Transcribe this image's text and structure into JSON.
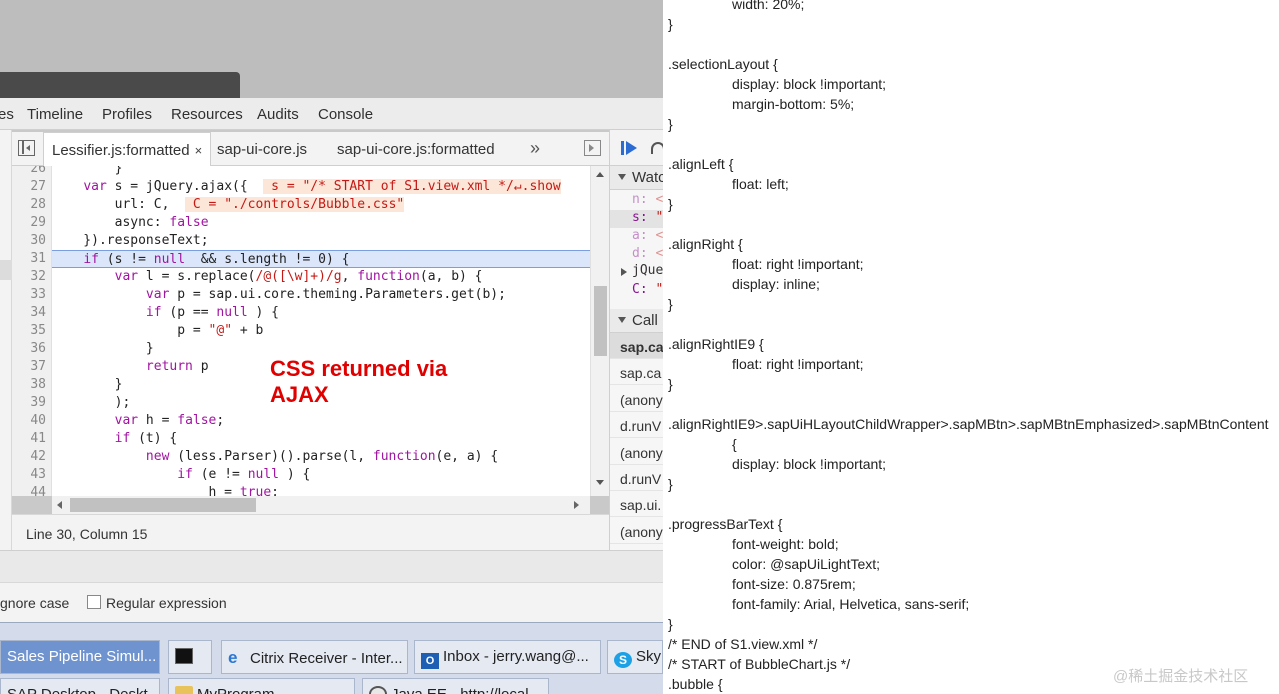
{
  "devtools": {
    "tabs": [
      "es",
      "Timeline",
      "Profiles",
      "Resources",
      "Audits",
      "Console"
    ],
    "file_tabs": [
      "Lessifier.js:formatted",
      "sap-ui-core.js",
      "sap-ui-core.js:formatted"
    ],
    "close_glyph": "×",
    "more_glyph": "»",
    "status": "Line 30, Column 15",
    "annotation": [
      "CSS returned via",
      "AJAX"
    ]
  },
  "code_lines": [
    {
      "n": "26",
      "html": "        }"
    },
    {
      "n": "27",
      "html": "    <span class=\"kw\">var</span> s = jQuery.ajax({  <span class=\"tip\"> s = \"/* START of S1.view.xml */↵.show</span>"
    },
    {
      "n": "28",
      "html": "        url: C,  <span class=\"tip\"> C = <span class=\"str\">\"./controls/Bubble.css\"</span></span>"
    },
    {
      "n": "29",
      "html": "        async: <span class=\"kw\">false</span>"
    },
    {
      "n": "30",
      "html": "    }).responseText;"
    },
    {
      "n": "31",
      "html": "    <span class=\"kw\">if</span> (s != <span class=\"kw\">null</span>  && s.length != 0) {",
      "hl": true
    },
    {
      "n": "32",
      "html": "        <span class=\"kw\">var</span> l = s.replace(<span class=\"re\">/@([\\w]+)/g</span>, <span class=\"kw\">function</span>(a, b) {"
    },
    {
      "n": "33",
      "html": "            <span class=\"kw\">var</span> p = sap.ui.core.theming.Parameters.get(b);"
    },
    {
      "n": "34",
      "html": "            <span class=\"kw\">if</span> (p == <span class=\"kw\">null</span> ) {"
    },
    {
      "n": "35",
      "html": "                p = <span class=\"str\">\"@\"</span> + b"
    },
    {
      "n": "36",
      "html": "            }"
    },
    {
      "n": "37",
      "html": "            <span class=\"kw\">return</span> p"
    },
    {
      "n": "38",
      "html": "        }"
    },
    {
      "n": "39",
      "html": "        );"
    },
    {
      "n": "40",
      "html": "        <span class=\"kw\">var</span> h = <span class=\"kw\">false</span>;"
    },
    {
      "n": "41",
      "html": "        <span class=\"kw\">if</span> (t) {"
    },
    {
      "n": "42",
      "html": "            <span class=\"kw\">new</span> (less.Parser)().parse(l, <span class=\"kw\">function</span>(e, a) {"
    },
    {
      "n": "43",
      "html": "                <span class=\"kw\">if</span> (e != <span class=\"kw\">null</span> ) {"
    },
    {
      "n": "44",
      "html": "                    h = <span class=\"kw\">true</span>;"
    },
    {
      "n": "45",
      "html": ""
    }
  ],
  "right_panel": {
    "watch_label": "Watc",
    "watch_items": [
      {
        "name": "n:",
        "value": "<",
        "dim": true
      },
      {
        "name": "s:",
        "value": "\"",
        "dim": false
      },
      {
        "name": "a:",
        "value": "<",
        "dim": true
      },
      {
        "name": "d:",
        "value": "<",
        "dim": true
      },
      {
        "name": "jQue",
        "value": "",
        "dim": false,
        "plain": true
      },
      {
        "name": "C:",
        "value": "\"",
        "dim": false
      }
    ],
    "call_label": "Call",
    "call_stack": [
      "sap.ca",
      "sap.ca",
      "(anony",
      "d.runV",
      "(anony",
      "d.runV",
      "sap.ui.",
      "(anony"
    ]
  },
  "search": {
    "ignore_case": "gnore case",
    "regex": "Regular expression"
  },
  "taskbar": {
    "row1": [
      "Sales Pipeline Simul...",
      "",
      "Citrix Receiver - Inter...",
      "Inbox - jerry.wang@...",
      "Sky"
    ],
    "row2": [
      "SAP Desktop - Deskt...",
      "MyProgram",
      "Java EE - http://local..."
    ],
    "outlook_glyph": "O",
    "skype_glyph": "S",
    "ie_glyph": "e"
  },
  "css_doc": {
    "lines": [
      {
        "t": "width: 20%;",
        "i": true
      },
      {
        "t": "}",
        "i": false
      },
      {
        "t": "",
        "i": false
      },
      {
        "t": ".selectionLayout {",
        "i": false
      },
      {
        "t": "display: block !important;",
        "i": true
      },
      {
        "t": "margin-bottom: 5%;",
        "i": true
      },
      {
        "t": "}",
        "i": false
      },
      {
        "t": "",
        "i": false
      },
      {
        "t": ".alignLeft {",
        "i": false
      },
      {
        "t": "float: left;",
        "i": true
      },
      {
        "t": "}",
        "i": false
      },
      {
        "t": "",
        "i": false
      },
      {
        "t": ".alignRight {",
        "i": false
      },
      {
        "t": "float: right !important;",
        "i": true
      },
      {
        "t": "display: inline;",
        "i": true
      },
      {
        "t": "}",
        "i": false
      },
      {
        "t": "",
        "i": false
      },
      {
        "t": ".alignRightIE9 {",
        "i": false
      },
      {
        "t": "float: right !important;",
        "i": true
      },
      {
        "t": "}",
        "i": false
      },
      {
        "t": "",
        "i": false
      },
      {
        "t": ".alignRightIE9>.sapUiHLayoutChildWrapper>.sapMBtn>.sapMBtnEmphasized>.sapMBtnContent",
        "i": false
      },
      {
        "t": "{",
        "i": true
      },
      {
        "t": "display: block !important;",
        "i": true
      },
      {
        "t": "}",
        "i": false
      },
      {
        "t": "",
        "i": false
      },
      {
        "t": ".progressBarText {",
        "i": false
      },
      {
        "t": "font-weight: bold;",
        "i": true
      },
      {
        "t": "color: @sapUiLightText;",
        "i": true
      },
      {
        "t": "font-size: 0.875rem;",
        "i": true
      },
      {
        "t": "font-family: Arial, Helvetica, sans-serif;",
        "i": true
      },
      {
        "t": "}",
        "i": false
      },
      {
        "t": "/* END of S1.view.xml */",
        "i": false
      },
      {
        "t": "/* START of BubbleChart.js */",
        "i": false
      },
      {
        "t": ".bubble {",
        "i": false
      }
    ]
  },
  "watermark": "@稀土掘金技术社区"
}
